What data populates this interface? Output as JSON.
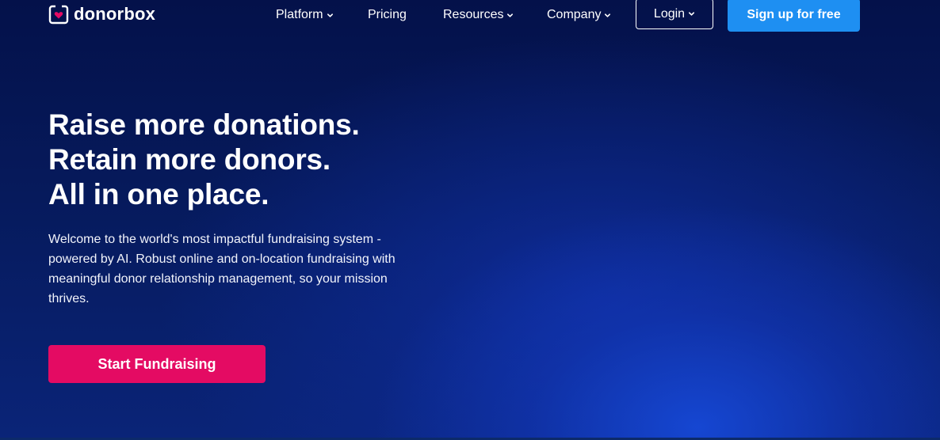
{
  "brand": {
    "name": "donorbox",
    "logo_icon": "heart-box-icon",
    "heart_color": "#e40b63"
  },
  "nav": {
    "items": [
      {
        "label": "Platform",
        "has_dropdown": true
      },
      {
        "label": "Pricing",
        "has_dropdown": false
      },
      {
        "label": "Resources",
        "has_dropdown": true
      },
      {
        "label": "Company",
        "has_dropdown": true
      }
    ],
    "login_label": "Login",
    "signup_label": "Sign up for free"
  },
  "hero": {
    "title_lines": [
      "Raise more donations.",
      "Retain more donors.",
      "All in one place."
    ],
    "description": "Welcome to the world's most impactful fundraising system - powered by AI. Robust online and on-location fundraising with meaningful donor relationship management, so your mission thrives.",
    "cta_label": "Start Fundraising"
  },
  "colors": {
    "background_dark": "#04114a",
    "background_glow": "#1648d6",
    "signup_button": "#1e8ff2",
    "cta_button": "#e40b63",
    "text": "#ffffff"
  }
}
